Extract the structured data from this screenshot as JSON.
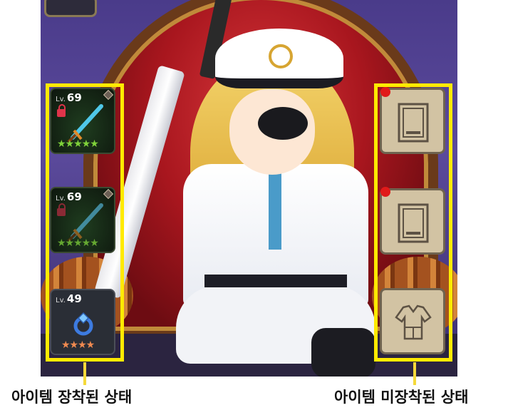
{
  "equipped_slots": [
    {
      "level_prefix": "Lv.",
      "level": "69",
      "stars": "★★★★★",
      "icon": "sword-icon",
      "locked": true
    },
    {
      "level_prefix": "Lv.",
      "level": "69",
      "stars": "★★★★★",
      "icon": "sword-icon",
      "locked": true
    },
    {
      "level_prefix": "Lv.",
      "level": "49",
      "stars": "★★★★",
      "icon": "ring-icon",
      "locked": false
    }
  ],
  "unequipped_slots": [
    {
      "icon": "card-slot-icon",
      "new_badge": true
    },
    {
      "icon": "card-slot-icon",
      "new_badge": true
    },
    {
      "icon": "clothing-icon",
      "new_badge": false
    }
  ],
  "captions": {
    "left": "아이템 장착된 상태",
    "right": "아이템 미장착된 상태"
  },
  "colors": {
    "highlight": "#ffea00",
    "new_badge": "#e01a1a",
    "star_green": "#7fd23a",
    "star_orange": "#f08a50"
  }
}
